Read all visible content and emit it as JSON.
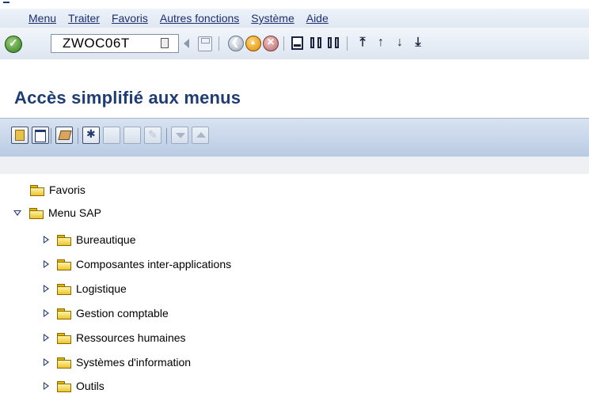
{
  "menubar": {
    "items": [
      "Menu",
      "Traiter",
      "Favoris",
      "Autres fonctions",
      "Système",
      "Aide"
    ]
  },
  "toolbar": {
    "command_field_value": "ZWOC06T",
    "icons": [
      "ok-icon",
      "clipboard-icon",
      "arrow-left-icon",
      "save-icon",
      "back-icon",
      "exit-icon",
      "cancel-icon",
      "print-icon",
      "find-icon",
      "find-next-icon",
      "first-page-icon",
      "prev-page-icon",
      "next-page-icon",
      "last-page-icon"
    ]
  },
  "page": {
    "title": "Accès simplifié aux menus"
  },
  "app_toolbar": {
    "buttons": [
      "add-favorite",
      "change-favorite",
      "delete-favorite",
      "create-role",
      "assign-users",
      "document",
      "edit-pencil",
      "expand-down",
      "collapse-up"
    ]
  },
  "tree": {
    "favorites_label": "Favoris",
    "menu_sap_label": "Menu SAP",
    "items": [
      {
        "label": "Bureautique"
      },
      {
        "label": "Composantes inter-applications"
      },
      {
        "label": "Logistique"
      },
      {
        "label": "Gestion comptable"
      },
      {
        "label": "Ressources humaines"
      },
      {
        "label": "Systèmes d'information"
      },
      {
        "label": "Outils"
      }
    ]
  },
  "colors": {
    "title": "#1f3d74",
    "menubar_bg": "#e6edf6",
    "app_toolbar_bg": "#c6d5ea",
    "folder": "#ecc62c"
  }
}
